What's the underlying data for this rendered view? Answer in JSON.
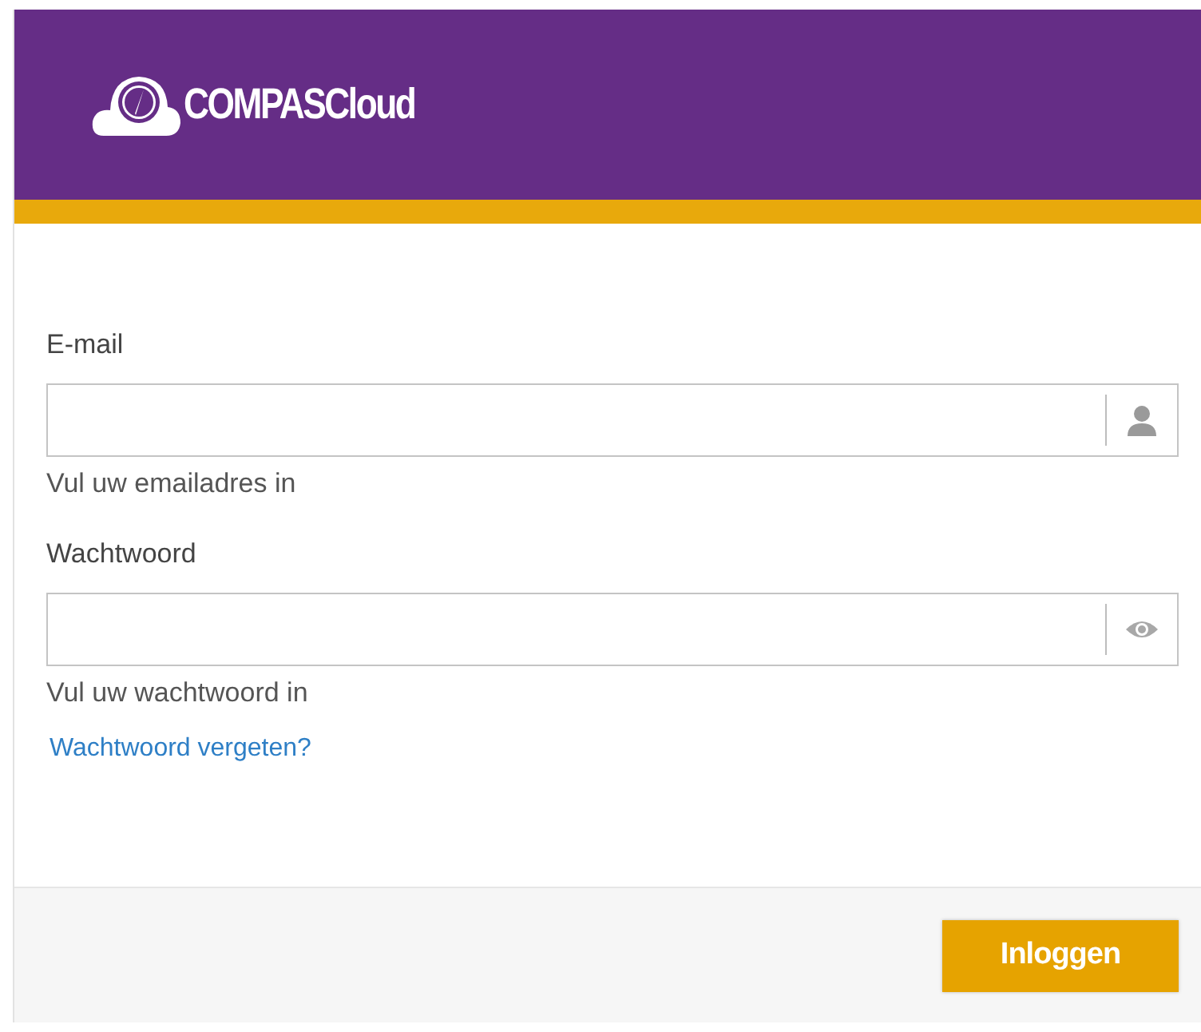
{
  "header": {
    "logo_text": "COMPASCloud"
  },
  "fields": [
    {
      "label": "E-mail",
      "kind": "user",
      "hint": "Vul uw emailadres in"
    },
    {
      "label": "Wachtwoord",
      "kind": "eye",
      "hint": "Vul uw wachtwoord in"
    }
  ],
  "forgot_link": "Wachtwoord vergeten?",
  "login_button": "Inloggen"
}
